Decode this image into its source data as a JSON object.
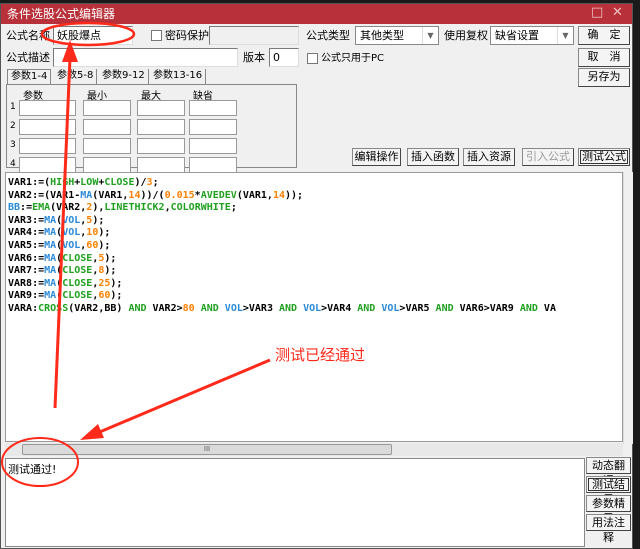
{
  "window": {
    "title": "条件选股公式编辑器",
    "maximize_icon": "□",
    "close_icon": "✕"
  },
  "form": {
    "name_label": "公式名称",
    "name_value": "妖股爆点",
    "password_label": "密码保护",
    "password_checked": false,
    "type_label": "公式类型",
    "type_value": "其他类型",
    "rights_label": "使用复权",
    "rights_value": "缺省设置",
    "desc_label": "公式描述",
    "desc_value": "",
    "version_label": "版本",
    "version_value": "0",
    "pc_only_label": "公式只用于PC",
    "pc_only_checked": false
  },
  "buttons": {
    "ok": "确　定",
    "cancel": "取　消",
    "save_as": "另存为",
    "edit_ops": "编辑操作",
    "insert_func": "插入函数",
    "insert_res": "插入资源",
    "import": "引入公式",
    "test": "测试公式"
  },
  "tabs": [
    "参数1-4",
    "参数5-8",
    "参数9-12",
    "参数13-16"
  ],
  "params": {
    "headers": [
      "参数",
      "最小",
      "最大",
      "缺省"
    ],
    "rows": [
      "1",
      "2",
      "3",
      "4"
    ]
  },
  "code_lines": [
    [
      [
        "VAR1:=(",
        "k"
      ],
      [
        "HIGH",
        "g"
      ],
      [
        "+",
        "k"
      ],
      [
        "LOW",
        "g"
      ],
      [
        "+",
        "k"
      ],
      [
        "CLOSE",
        "g"
      ],
      [
        ")/",
        "k"
      ],
      [
        "3",
        "o"
      ],
      [
        ";",
        "k"
      ]
    ],
    [
      [
        "VAR2:=(VAR1-",
        "k"
      ],
      [
        "MA",
        "f"
      ],
      [
        "(VAR1,",
        "k"
      ],
      [
        "14",
        "o"
      ],
      [
        "))/(",
        "k"
      ],
      [
        "0.015",
        "o"
      ],
      [
        "*",
        "k"
      ],
      [
        "AVEDEV",
        "g"
      ],
      [
        "(VAR1,",
        "k"
      ],
      [
        "14",
        "o"
      ],
      [
        "));",
        "k"
      ]
    ],
    [
      [
        "BB",
        "f"
      ],
      [
        ":=",
        "k"
      ],
      [
        "EMA",
        "g"
      ],
      [
        "(VAR2,",
        "k"
      ],
      [
        "2",
        "o"
      ],
      [
        "),",
        "k"
      ],
      [
        "LINETHICK2",
        "g"
      ],
      [
        ",",
        "k"
      ],
      [
        "COLORWHITE",
        "g"
      ],
      [
        ";",
        "k"
      ]
    ],
    [
      [
        "VAR3:=",
        "k"
      ],
      [
        "MA",
        "f"
      ],
      [
        "(",
        "k"
      ],
      [
        "VOL",
        "f"
      ],
      [
        ",",
        "k"
      ],
      [
        "5",
        "o"
      ],
      [
        ");",
        "k"
      ]
    ],
    [
      [
        "VAR4:=",
        "k"
      ],
      [
        "MA",
        "f"
      ],
      [
        "(",
        "k"
      ],
      [
        "VOL",
        "f"
      ],
      [
        ",",
        "k"
      ],
      [
        "10",
        "o"
      ],
      [
        ");",
        "k"
      ]
    ],
    [
      [
        "VAR5:=",
        "k"
      ],
      [
        "MA",
        "f"
      ],
      [
        "(",
        "k"
      ],
      [
        "VOL",
        "f"
      ],
      [
        ",",
        "k"
      ],
      [
        "60",
        "o"
      ],
      [
        ");",
        "k"
      ]
    ],
    [
      [
        "VAR6:=",
        "k"
      ],
      [
        "MA",
        "f"
      ],
      [
        "(",
        "k"
      ],
      [
        "CLOSE",
        "g"
      ],
      [
        ",",
        "k"
      ],
      [
        "5",
        "o"
      ],
      [
        ");",
        "k"
      ]
    ],
    [
      [
        "VAR7:=",
        "k"
      ],
      [
        "MA",
        "f"
      ],
      [
        "(",
        "k"
      ],
      [
        "CLOSE",
        "g"
      ],
      [
        ",",
        "k"
      ],
      [
        "8",
        "o"
      ],
      [
        ");",
        "k"
      ]
    ],
    [
      [
        "VAR8:=",
        "k"
      ],
      [
        "MA",
        "f"
      ],
      [
        "(",
        "k"
      ],
      [
        "CLOSE",
        "g"
      ],
      [
        ",",
        "k"
      ],
      [
        "25",
        "o"
      ],
      [
        ");",
        "k"
      ]
    ],
    [
      [
        "VAR9:=",
        "k"
      ],
      [
        "MA",
        "f"
      ],
      [
        "(",
        "k"
      ],
      [
        "CLOSE",
        "g"
      ],
      [
        ",",
        "k"
      ],
      [
        "60",
        "o"
      ],
      [
        ");",
        "k"
      ]
    ],
    [
      [
        "VARA:",
        "k"
      ],
      [
        "CROSS",
        "g"
      ],
      [
        "(VAR2,BB) ",
        "k"
      ],
      [
        "AND",
        "g"
      ],
      [
        " VAR2>",
        "k"
      ],
      [
        "80",
        "o"
      ],
      [
        " ",
        "k"
      ],
      [
        "AND",
        "g"
      ],
      [
        " ",
        "k"
      ],
      [
        "VOL",
        "f"
      ],
      [
        ">VAR3 ",
        "k"
      ],
      [
        "AND",
        "g"
      ],
      [
        " ",
        "k"
      ],
      [
        "VOL",
        "f"
      ],
      [
        ">VAR4 ",
        "k"
      ],
      [
        "AND",
        "g"
      ],
      [
        " ",
        "k"
      ],
      [
        "VOL",
        "f"
      ],
      [
        ">VAR5 ",
        "k"
      ],
      [
        "AND",
        "g"
      ],
      [
        " VAR6>VAR9 ",
        "k"
      ],
      [
        "AND",
        "g"
      ],
      [
        " VA",
        "k"
      ]
    ]
  ],
  "output": {
    "text": "测试通过!"
  },
  "side_buttons": [
    "动态翻译",
    "测试结果",
    "参数精灵",
    "用法注释"
  ],
  "annotation": {
    "text": "测试已经通过",
    "color": "#ff2a1a"
  },
  "colors": {
    "titlebar": "#b8313a",
    "func": "#2b8ad8",
    "keyword": "#1fa01f",
    "number": "#ff8000"
  }
}
